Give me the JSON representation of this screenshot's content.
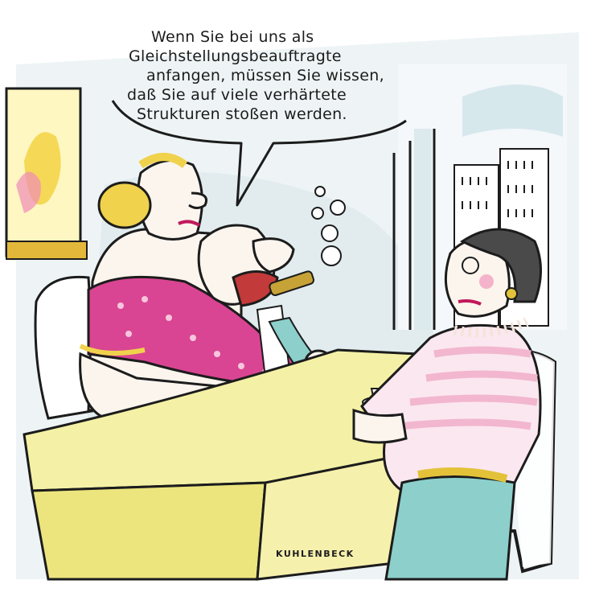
{
  "cartoon": {
    "speech_lines": [
      "Wenn Sie bei uns als",
      "Gleichstellungsbeauftragte",
      "anfangen, müssen Sie wissen,",
      "daß Sie auf viele verhärtete",
      "Strukturen stoßen werden."
    ],
    "signature": "KUHLENBECK"
  },
  "colors": {
    "wall": "#e8f0f3",
    "window_frame": "#e3b83a",
    "table_top": "#f4f1a6",
    "table_side": "#ece57e",
    "dress": "#d94592",
    "skin": "#fbf5ee",
    "stripes_pink": "#f2b6cf",
    "tie": "#8ccfcb",
    "hair_blond": "#f0d24c",
    "hair_dark": "#4a4a4a",
    "skyline": "#cfd9de",
    "outline": "#1c1c1c"
  }
}
